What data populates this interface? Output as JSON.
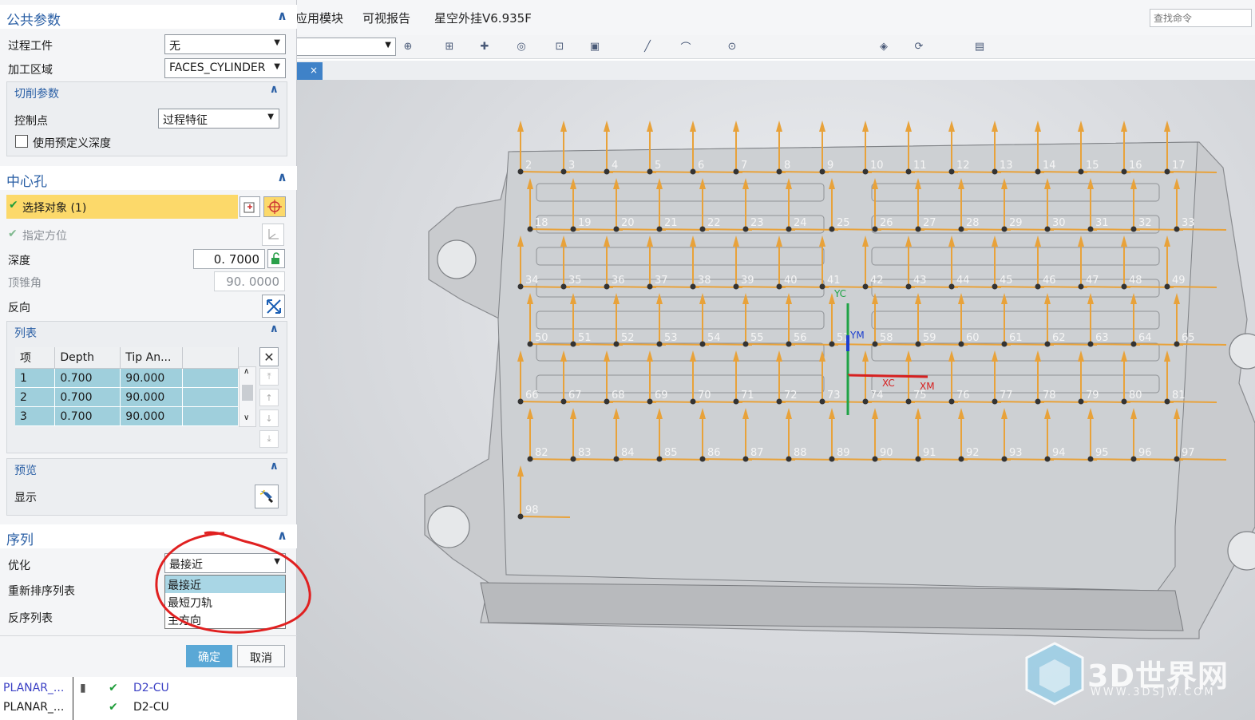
{
  "menubar": {
    "items": [
      "应用模块",
      "可视报告",
      "星空外挂V6.935F"
    ],
    "find_placeholder": "查找命令"
  },
  "toolbar": {
    "filter_value": "",
    "icons": [
      "snap-icon",
      "select-icon",
      "point-icon",
      "circle-icon",
      "box-select-icon",
      "cube-icon",
      "line-icon",
      "arc-icon",
      "crosshair-icon",
      "view-icon",
      "rotate-icon",
      "layer-icon"
    ]
  },
  "tab": {
    "label": "×"
  },
  "dialog": {
    "common_params": {
      "title": "公共参数",
      "process_part_label": "过程工件",
      "process_part_value": "无",
      "machining_area_label": "加工区域",
      "machining_area_value": "FACES_CYLINDER",
      "cut_params": {
        "title": "切削参数",
        "control_point_label": "控制点",
        "control_point_value": "过程特征",
        "use_predefined_depth_label": "使用预定义深度"
      }
    },
    "center_hole": {
      "title": "中心孔",
      "select_object_label": "选择对象 (1)",
      "specify_orientation_label": "指定方位",
      "depth_label": "深度",
      "depth_value": "0. 7000",
      "tip_angle_label": "顶锥角",
      "tip_angle_value": "90. 0000",
      "reverse_label": "反向",
      "list": {
        "title": "列表",
        "columns": [
          "项",
          "Depth",
          "Tip An...",
          ""
        ],
        "rows": [
          [
            "1",
            "0.700",
            "90.000",
            ""
          ],
          [
            "2",
            "0.700",
            "90.000",
            ""
          ],
          [
            "3",
            "0.700",
            "90.000",
            ""
          ]
        ]
      },
      "preview": {
        "title": "预览",
        "display_label": "显示"
      }
    },
    "sequence": {
      "title": "序列",
      "optimize_label": "优化",
      "optimize_value": "最接近",
      "reorder_label": "重新排序列表",
      "reverse_label": "反序列表",
      "options": [
        "最接近",
        "最短刀轨",
        "主方向"
      ]
    },
    "ok_label": "确定",
    "cancel_label": "取消"
  },
  "navigator": {
    "rows": [
      {
        "name": "PLANAR_...",
        "tool": "D2-CU"
      },
      {
        "name": "PLANAR_...",
        "tool": "D2-CU"
      }
    ]
  },
  "viewport": {
    "hole_labels": [
      "2",
      "3",
      "4",
      "5",
      "6",
      "7",
      "8",
      "9",
      "10",
      "11",
      "12",
      "13",
      "14",
      "15",
      "16",
      "17",
      "18",
      "19",
      "20",
      "21",
      "22",
      "23",
      "24",
      "25",
      "26",
      "27",
      "28",
      "29",
      "30",
      "31",
      "32",
      "33",
      "34",
      "35",
      "36",
      "37",
      "38",
      "39",
      "40",
      "41",
      "42",
      "43",
      "44",
      "45",
      "46",
      "47",
      "48",
      "49",
      "50",
      "51",
      "52",
      "53",
      "54",
      "55",
      "56",
      "57",
      "58",
      "59",
      "60",
      "61",
      "62",
      "63",
      "64",
      "65",
      "66",
      "67",
      "68",
      "69",
      "70",
      "71",
      "72",
      "73",
      "74",
      "75",
      "76",
      "77",
      "78",
      "79",
      "80",
      "81",
      "82",
      "83",
      "84",
      "85",
      "86",
      "87",
      "88",
      "89",
      "90",
      "91",
      "92",
      "93",
      "94",
      "95",
      "96",
      "97",
      "98"
    ],
    "axis_labels": {
      "yc": "YC",
      "xc": "XC",
      "ym": "YM",
      "xm": "XM"
    },
    "watermark_text": "3D世界网",
    "watermark_url": "WWW.3DSJW.COM"
  },
  "colors": {
    "accent_blue": "#2a5fa5",
    "select_highlight": "#fcd96a",
    "list_row": "#9fcfdc",
    "dropdown_selected": "#a9d6e5",
    "arrow_orange": "#e8a23a",
    "annotation_red": "#e02020"
  }
}
